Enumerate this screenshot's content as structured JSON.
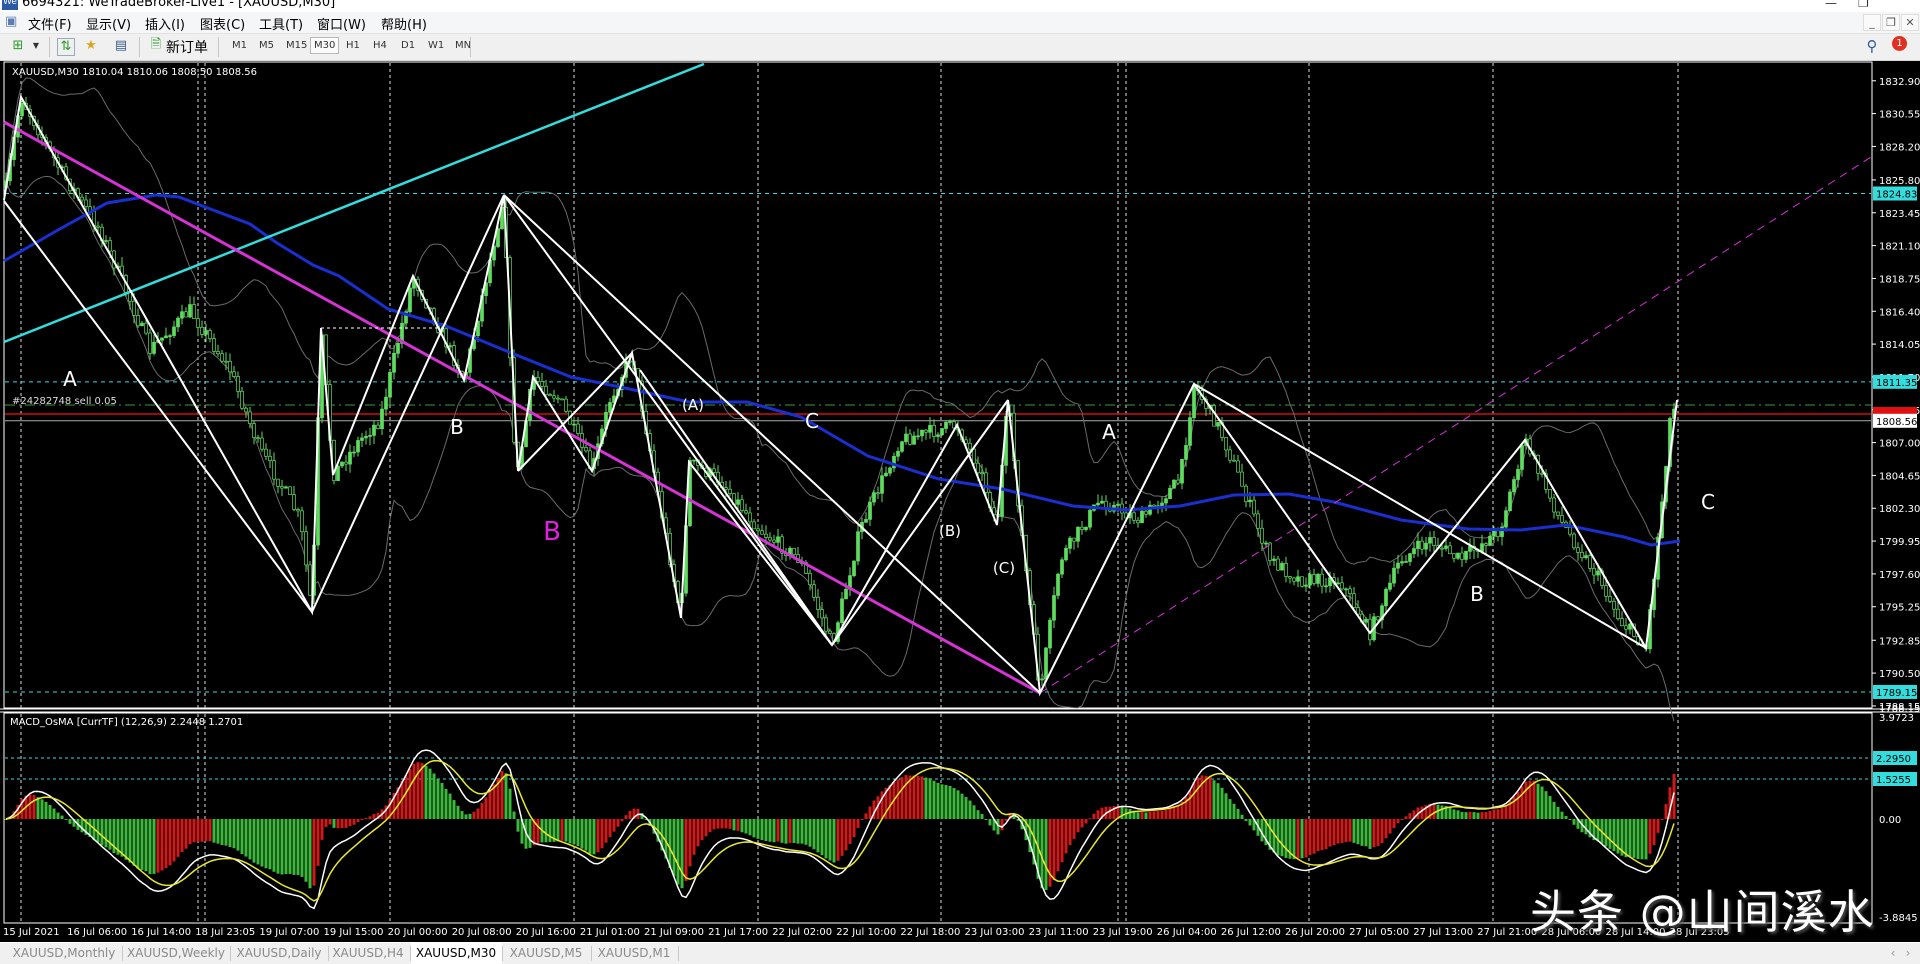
{
  "window": {
    "title": "6694321: WeTradeBroker-Live1 - [XAUUSD,M30]",
    "logo": "We"
  },
  "menu": [
    "文件(F)",
    "显示(V)",
    "插入(I)",
    "图表(C)",
    "工具(T)",
    "窗口(W)",
    "帮助(H)"
  ],
  "toolbar": {
    "new_order": "新订单",
    "timeframes": [
      "M1",
      "M5",
      "M15",
      "M30",
      "H1",
      "H4",
      "D1",
      "W1",
      "MN"
    ],
    "active_timeframe": "M30",
    "notification_count": "1"
  },
  "chart": {
    "symbol_info": "XAUUSD,M30  1810.04 1810.06 1808.50 1808.56",
    "order_label": "#24282748 sell 0.05",
    "price_axis": [
      "1832.90",
      "1830.55",
      "1828.20",
      "1825.80",
      "1823.45",
      "1821.10",
      "1818.75",
      "1816.40",
      "1814.05",
      "1811.70",
      "1809.35",
      "1807.00",
      "1804.65",
      "1802.30",
      "1799.95",
      "1797.60",
      "1795.25",
      "1792.85",
      "1790.50",
      "1788.15"
    ],
    "price_boxes": {
      "level_high": "1824.83",
      "level_mid": "1811.35",
      "bid": "1808.56",
      "level_low": "1789.15"
    },
    "annotations": [
      {
        "text": "A",
        "color": "#ffffff"
      },
      {
        "text": "B",
        "color": "#ffffff"
      },
      {
        "text": "B",
        "color": "#e020e0"
      },
      {
        "text": "(A)",
        "color": "#ffffff"
      },
      {
        "text": "C",
        "color": "#ffffff"
      },
      {
        "text": "(B)",
        "color": "#ffffff"
      },
      {
        "text": "(C)",
        "color": "#ffffff"
      },
      {
        "text": "A",
        "color": "#ffffff"
      },
      {
        "text": "B",
        "color": "#ffffff"
      },
      {
        "text": "C",
        "color": "#ffffff"
      }
    ],
    "time_axis": [
      "15 Jul 2021",
      "16 Jul 06:00",
      "16 Jul 14:00",
      "18 Jul 23:05",
      "19 Jul 07:00",
      "19 Jul 15:00",
      "20 Jul 00:00",
      "20 Jul 08:00",
      "20 Jul 16:00",
      "21 Jul 01:00",
      "21 Jul 09:00",
      "21 Jul 17:00",
      "22 Jul 02:00",
      "22 Jul 10:00",
      "22 Jul 18:00",
      "23 Jul 03:00",
      "23 Jul 11:00",
      "23 Jul 19:00",
      "26 Jul 04:00",
      "26 Jul 12:00",
      "26 Jul 20:00",
      "27 Jul 05:00",
      "27 Jul 13:00",
      "27 Jul 21:00",
      "28 Jul 06:00",
      "28 Jul 14:00",
      "28 Jul 23:05"
    ]
  },
  "indicator": {
    "label": "MACD_OsMA [CurrTF] (12,26,9) 2.2448 1.2701",
    "axis_max": "3.9723",
    "axis_zero": "0.00",
    "axis_min": "-3.8845",
    "level_boxes": [
      "2.2950",
      "1.5255"
    ]
  },
  "tabs": [
    "XAUUSD,Monthly",
    "XAUUSD,Weekly",
    "XAUUSD,Daily",
    "XAUUSD,H4",
    "XAUUSD,M30",
    "XAUUSD,M5",
    "XAUUSD,M1"
  ],
  "active_tab": "XAUUSD,M30",
  "watermark": "头条 @山间溪水",
  "colors": {
    "background": "#000000",
    "candle": "#5fdc5f",
    "moving_average": "#1a2fd0",
    "trend_line_magenta": "#d633d6",
    "channel_cyan": "#33dddd",
    "zigzag": "#ffffff",
    "histogram_up": "#3cb93c",
    "histogram_down": "#d01a1a",
    "macd_line": "#ffffff",
    "signal_line": "#e8e830",
    "order_line": "#cc1111"
  }
}
